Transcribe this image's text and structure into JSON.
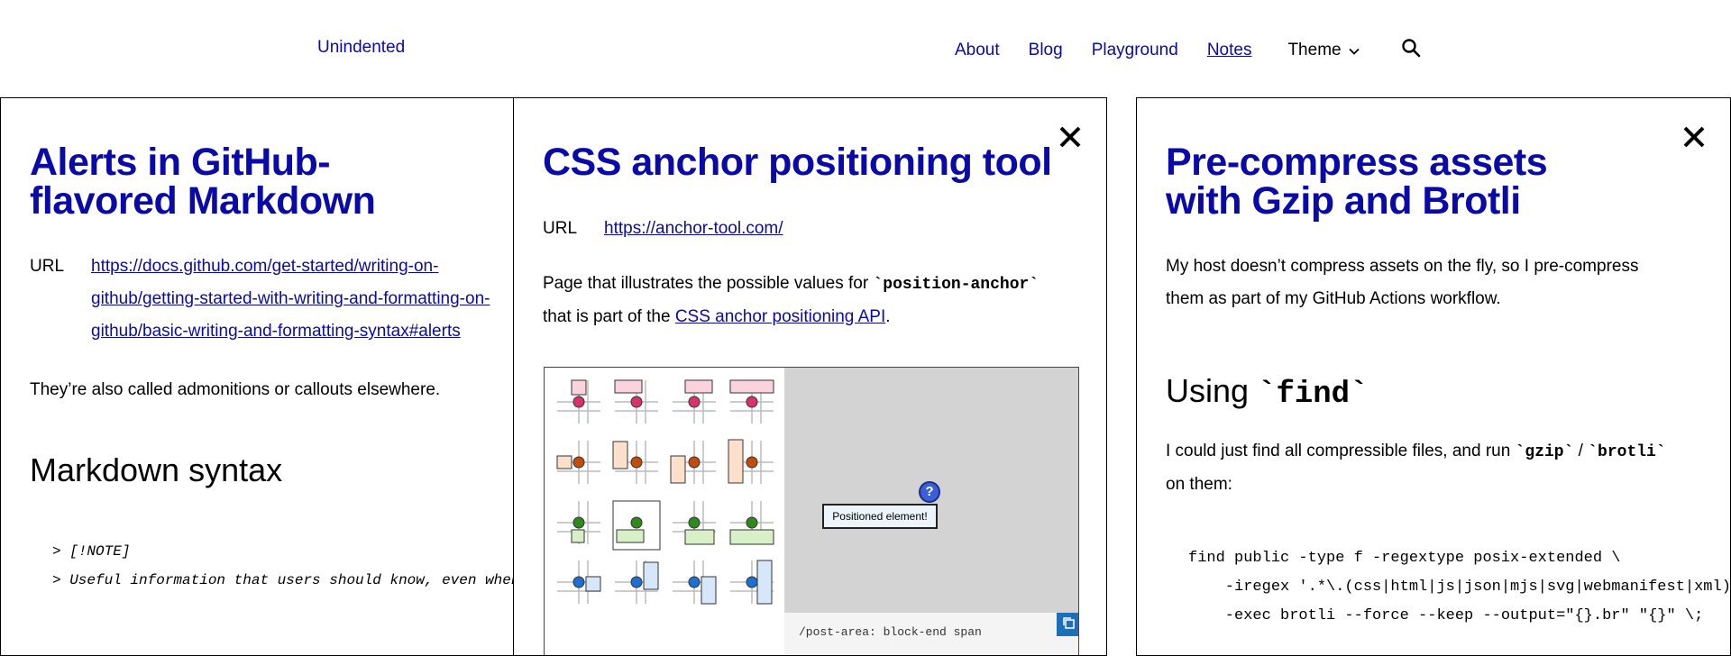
{
  "site": {
    "logo": "Unindented",
    "nav": [
      {
        "label": "About"
      },
      {
        "label": "Blog"
      },
      {
        "label": "Playground"
      },
      {
        "label": "Notes",
        "current": true
      }
    ],
    "theme_label": "Theme",
    "icons": {
      "theme": "chevron-down-icon",
      "search": "search-icon",
      "close": "close-icon",
      "copy": "copy-icon"
    }
  },
  "cards": [
    {
      "title_line1": "Alerts in GitHub-",
      "title_line2": "flavored Markdown",
      "url_label": "URL",
      "url_line1": "https://docs.github.com/get-started/writing-on-",
      "url_line2": "github/getting-started-with-writing-and-formatting-on-",
      "url_line3": "github/basic-writing-and-formatting-syntax#alerts",
      "paragraph": "They’re also called admonitions or callouts elsewhere.",
      "heading": "Markdown syntax",
      "code_lines": [
        "> [!NOTE]",
        "> Useful information that users should know, even when skimming content."
      ]
    },
    {
      "title": "CSS anchor positioning tool",
      "url_label": "URL",
      "url": "https://anchor-tool.com/",
      "text_before": "Page that illustrates the possible values for ",
      "code": "`position-anchor`",
      "text_line2_before": "that is part of the ",
      "link": "CSS anchor positioning API",
      "text_after": ".",
      "preview": {
        "badge": "Positioned element!",
        "q_mark": "?",
        "snippet": "/post-area: block-end span"
      }
    },
    {
      "title_line1": "Pre-compress assets",
      "title_line2": "with Gzip and Brotli",
      "paragraph_line1": "My host doesn’t compress assets on the fly, so I pre-compress",
      "paragraph_line2": "them as part of my GitHub Actions workflow.",
      "heading_text": "Using ",
      "heading_code": "`find`",
      "para2_before": "I could just find all compressible files, and run ",
      "para2_code1": "`gzip`",
      "para2_sep": " / ",
      "para2_code2": "`brotli`",
      "para2_line2": "on them:",
      "code_lines": [
        "find public -type f -regextype posix-extended \\",
        "    -iregex '.*\\.(css|html|js|json|mjs|svg|webmanifest|xml)' \\",
        "    -exec brotli --force --keep --output=\"{}.br\" \"{}\" \\;"
      ]
    }
  ],
  "colors": {
    "link": "#0a0aa8",
    "border": "#000000",
    "preview_gray": "#d3d3d3"
  }
}
